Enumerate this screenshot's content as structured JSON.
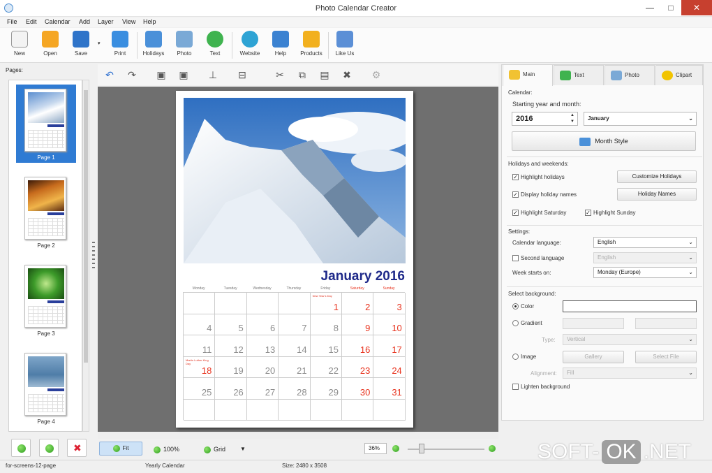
{
  "window": {
    "title": "Photo Calendar Creator",
    "minimize": "—",
    "maximize": "□",
    "close": "✕"
  },
  "menu": [
    "File",
    "Edit",
    "Calendar",
    "Add",
    "Layer",
    "View",
    "Help"
  ],
  "toolbar": [
    "New",
    "Open",
    "Save",
    "Print",
    "Holidays",
    "Photo",
    "Text",
    "Website",
    "Help",
    "Products",
    "Like Us"
  ],
  "pages": {
    "label": "Pages:",
    "items": [
      "Page 1",
      "Page 2",
      "Page 3",
      "Page 4"
    ]
  },
  "calendar": {
    "title": "January 2016",
    "weekdays": [
      "Monday",
      "Tuesday",
      "Wednesday",
      "Thursday",
      "Friday",
      "Saturday",
      "Sunday"
    ],
    "weeks": [
      [
        "",
        "",
        "",
        "",
        "1",
        "2",
        "3"
      ],
      [
        "4",
        "5",
        "6",
        "7",
        "8",
        "9",
        "10"
      ],
      [
        "11",
        "12",
        "13",
        "14",
        "15",
        "16",
        "17"
      ],
      [
        "18",
        "19",
        "20",
        "21",
        "22",
        "23",
        "24"
      ],
      [
        "25",
        "26",
        "27",
        "28",
        "29",
        "30",
        "31"
      ],
      [
        "",
        "",
        "",
        "",
        "",
        "",
        ""
      ]
    ],
    "holidays": {
      "friday1": "New Year's Day",
      "monday18": "Martin Luther King Day"
    }
  },
  "right_panel": {
    "tabs": [
      "Main",
      "Text",
      "Photo",
      "Clipart"
    ],
    "calendar_section": "Calendar:",
    "starting_label": "Starting year and month:",
    "year": "2016",
    "month": "January",
    "month_style": "Month Style",
    "holidays_section": "Holidays and weekends:",
    "highlight_holidays": "Highlight holidays",
    "display_holiday_names": "Display holiday names",
    "highlight_saturday": "Highlight Saturday",
    "highlight_sunday": "Highlight Sunday",
    "customize_holidays": "Customize Holidays",
    "holiday_names": "Holiday Names",
    "settings_section": "Settings:",
    "calendar_language_label": "Calendar language:",
    "calendar_language": "English",
    "second_language_label": "Second language",
    "second_language": "English",
    "week_starts_label": "Week starts on:",
    "week_starts": "Monday (Europe)",
    "background_section": "Select background:",
    "color_label": "Color",
    "gradient_label": "Gradient",
    "type_label": "Type:",
    "type_value": "Vertical",
    "image_label": "Image",
    "gallery_btn": "Gallery",
    "select_file_btn": "Select File",
    "alignment_label": "Alignment:",
    "alignment_value": "Fill",
    "lighten_background": "Lighten background"
  },
  "bottom": {
    "fit": "Fit",
    "zoom100": "100%",
    "grid": "Grid",
    "zoom_value": "36%"
  },
  "status": {
    "file": "for-screens-12-page",
    "type": "Yearly Calendar",
    "size": "Size: 2480 x 3508"
  },
  "watermark": {
    "left": "SOFT-",
    "ok": "OK",
    "right": ".NET"
  },
  "colors": {
    "accent": "#2f7bd3",
    "weekend": "#e8341f",
    "title": "#1f2a8a"
  }
}
